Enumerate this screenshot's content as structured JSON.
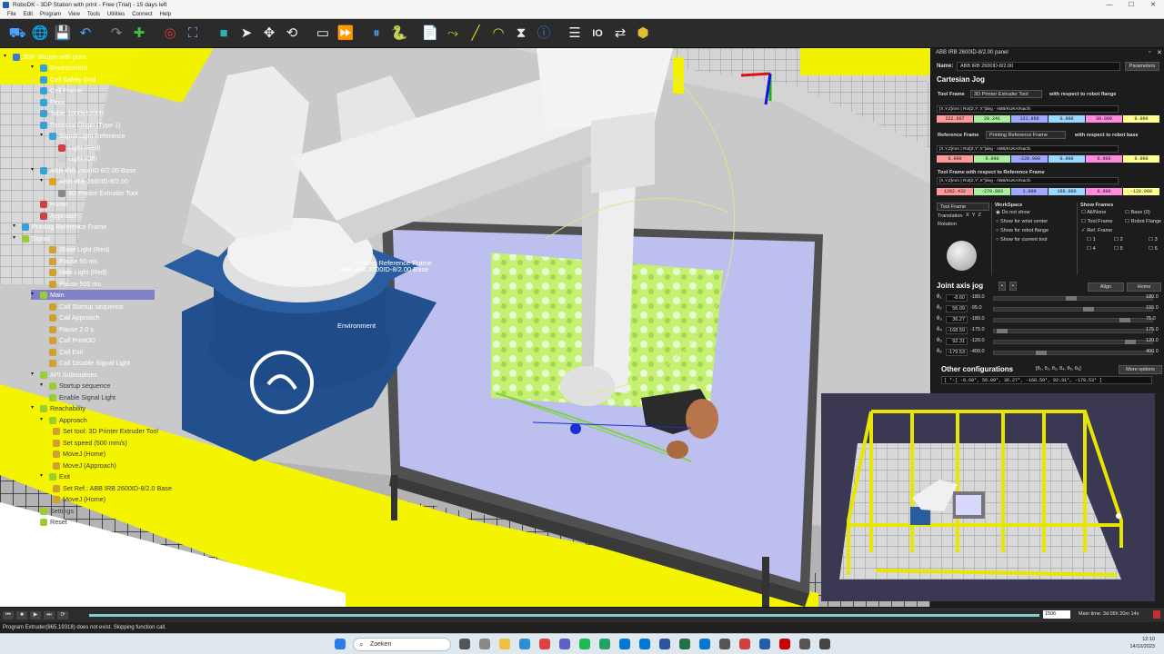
{
  "window": {
    "title": "RoboDK - 3DP Station with print - Free (Trial) - 15 days left",
    "controls": [
      "—",
      "☐",
      "✕"
    ]
  },
  "menu": [
    "File",
    "Edit",
    "Program",
    "View",
    "Tools",
    "Utilities",
    "Connect",
    "Help"
  ],
  "toolbar_icons": [
    "open-icon",
    "globe-icon",
    "save-icon",
    "undo-icon",
    "redo-icon",
    "add-frame-icon",
    "target-icon",
    "fit-all-icon",
    "cube-icon",
    "select-icon",
    "move-icon",
    "rotate-icon",
    "shelf-icon",
    "run-icon",
    "pause-icon",
    "python-icon",
    "new-program-icon",
    "move-joint-icon",
    "move-linear-icon",
    "move-circular-icon",
    "wait-icon",
    "info-icon",
    "instruction-icon",
    "io-icon",
    "sync-icon",
    "package-icon"
  ],
  "tree": {
    "items": [
      {
        "label": "3DP Station with print",
        "color": "#3b7ad8"
      },
      {
        "label": "Environment",
        "color": "#3aa0d8"
      },
      {
        "label": "Cell Safety Grid",
        "color": "#3aa0d8"
      },
      {
        "label": "Cell Frame",
        "color": "#3aa0d8"
      },
      {
        "label": "Floor",
        "color": "#3aa0d8"
      },
      {
        "label": "Table 1000x1200h",
        "color": "#3aa0d8"
      },
      {
        "label": "Pedestal Origin (Type 1)",
        "color": "#3aa0d8"
      },
      {
        "label": "Signal Light Reference",
        "color": "#3aa0d8"
      },
      {
        "label": "Light (Red)",
        "color": "#d04040"
      },
      {
        "label": "Light (Off)",
        "color": "#d0d0d0"
      },
      {
        "label": "ABB IRB 2600ID-8/2.00 Base",
        "color": "#3aa0d8"
      },
      {
        "label": "ABB IRB 2600ID-8/2.00",
        "color": "#e0a020"
      },
      {
        "label": "3D Printer Extruder Tool",
        "color": "#888888"
      },
      {
        "label": "Home",
        "color": "#d04040"
      },
      {
        "label": "Approach",
        "color": "#d04040"
      },
      {
        "label": "Printing Reference Frame",
        "color": "#3aa0d8"
      },
      {
        "label": "Signal",
        "color": "#9acd32"
      },
      {
        "label": "Show Light (Red)",
        "color": "#d0a030"
      },
      {
        "label": "Pause 50 ms",
        "color": "#d0a030"
      },
      {
        "label": "Hide Light (Red)",
        "color": "#d0a030"
      },
      {
        "label": "Pause 500 ms",
        "color": "#d0a030"
      },
      {
        "label": "Main",
        "color": "#9acd32"
      },
      {
        "label": "Call Startup sequence",
        "color": "#d0a030"
      },
      {
        "label": "Call Approach",
        "color": "#d0a030"
      },
      {
        "label": "Pause 2.0 s",
        "color": "#d0a030"
      },
      {
        "label": "Call PrintOD",
        "color": "#d0a030"
      },
      {
        "label": "Call Exit",
        "color": "#d0a030"
      },
      {
        "label": "Call Disable Signal Light",
        "color": "#d0a030"
      },
      {
        "label": "API Subroutines",
        "color": "#9acd32"
      },
      {
        "label": "Startup sequence",
        "color": "#9acd32"
      },
      {
        "label": "Enable Signal Light",
        "color": "#9acd32"
      },
      {
        "label": "Reachability",
        "color": "#9acd32"
      },
      {
        "label": "Approach",
        "color": "#9acd32"
      },
      {
        "label": "Set tool: 3D Printer Extruder Tool",
        "color": "#d0a030"
      },
      {
        "label": "Set speed (500 mm/s)",
        "color": "#d0a030"
      },
      {
        "label": "MoveJ (Home)",
        "color": "#d0a030"
      },
      {
        "label": "MoveJ (Approach)",
        "color": "#d0a030"
      },
      {
        "label": "Exit",
        "color": "#9acd32"
      },
      {
        "label": "Set Ref.: ABB IRB 2600ID-8/2.0 Base",
        "color": "#d0a030"
      },
      {
        "label": "MoveJ (Home)",
        "color": "#d0a030"
      },
      {
        "label": "Settings",
        "color": "#9acd32"
      },
      {
        "label": "Reset",
        "color": "#9acd32"
      }
    ]
  },
  "viewport_labels": {
    "base": "ABB IRB 2600ID-8/2.00 Base",
    "ref": "Printing Reference Frame",
    "env": "Environment"
  },
  "panel": {
    "title": "ABB IRB 2600ID-8/2.00 panel",
    "name_label": "Name:",
    "name_value": "ABB IRB 2600ID-8/2.00",
    "params_btn": "Parameters",
    "cartesian_title": "Cartesian Jog",
    "tool_frame_label": "Tool Frame",
    "tool_frame_value": "3D Printer Extruder Tool",
    "wrt_flange": "with respect to robot flange",
    "pose_format": "[X,Y,Z]mm | Rot[Z,Y',X'']deg - ABB/KUKA/Nachi",
    "tool_values": [
      "222.667",
      "20.241",
      "121.966",
      "0.000",
      "30.000",
      "0.000"
    ],
    "ref_frame_label": "Reference Frame",
    "ref_frame_value": "Printing Reference Frame",
    "wrt_base": "with respect to robot base",
    "ref_values": [
      "0.000",
      "0.000",
      "-220.000",
      "0.000",
      "0.000",
      "0.000"
    ],
    "tool_ref_title": "Tool Frame with respect to Reference Frame",
    "tool_ref_values": [
      "1282.432",
      "-279.893",
      "1.000",
      "160.000",
      "0.000",
      "-120.000"
    ],
    "jog_frame": "Tool Frame",
    "jog_cols": [
      "X",
      "Y",
      "Z"
    ],
    "jog_translation": "Translation",
    "jog_rotation": "Rotation",
    "workspace_title": "WorkSpace",
    "workspace_opts": [
      "Do not show",
      "Show for wrist center",
      "Show for robot flange",
      "Show for current tool"
    ],
    "showframes_title": "Show Frames",
    "showframes_opts": [
      "All/None",
      "Tool Frame",
      "Ref. Frame",
      "1",
      "2",
      "3",
      "4",
      "5",
      "6",
      "Base (0)",
      "Robot Flange"
    ],
    "joint_title": "Joint axis jog",
    "align_btn": "Align",
    "home_btn": "Home",
    "joints": [
      {
        "label": "θ₁",
        "value": "-8.60",
        "min": "-180.0",
        "max": "180.0",
        "pos": 0.48
      },
      {
        "label": "θ₂",
        "value": "56.09",
        "min": "-95.0",
        "max": "155.0",
        "pos": 0.6
      },
      {
        "label": "θ₃",
        "value": "36.27",
        "min": "-180.0",
        "max": "75.0",
        "pos": 0.84
      },
      {
        "label": "θ₄",
        "value": "-168.59",
        "min": "-175.0",
        "max": "175.0",
        "pos": 0.02
      },
      {
        "label": "θ₅",
        "value": "92.31",
        "min": "-120.0",
        "max": "120.0",
        "pos": 0.88
      },
      {
        "label": "θ₆",
        "value": "-179.53",
        "min": "-400.0",
        "max": "400.0",
        "pos": 0.28
      }
    ],
    "other_title": "Other configurations",
    "other_format": "[θ₁, θ₂, θ₃, θ₄, θ₅, θ₆]",
    "more_options": "More options",
    "other_value": "[ *-[  -8.60°,  56.09°,  36.27°,  -168.59°,  92.31°,  -179.53° ]"
  },
  "status": {
    "frame_value": "1506",
    "main_time": "Main time: 3d 06h 20m 14s"
  },
  "message": "Program Extruder(865.19318) does not exist. Skipping function call.",
  "taskbar": {
    "search": "Zoeken",
    "time": "12:10",
    "date": "14/10/2023"
  }
}
